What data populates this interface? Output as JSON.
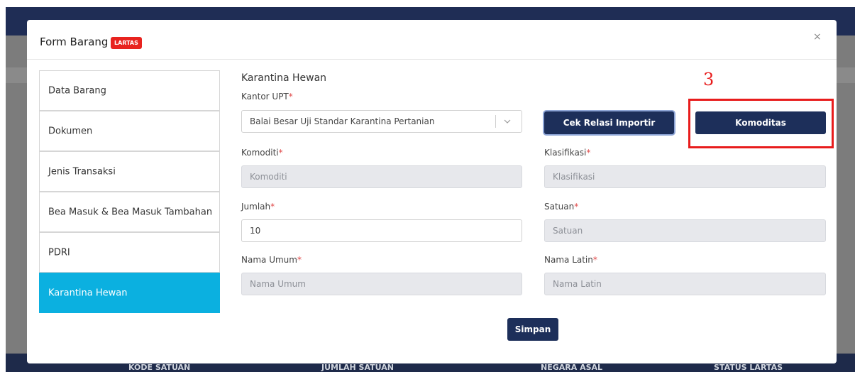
{
  "background": {
    "footer_columns": [
      "KODE SATUAN",
      "JUMLAH SATUAN",
      "NEGARA ASAL",
      "STATUS LARTAS"
    ]
  },
  "modal": {
    "title": "Form Barang",
    "badge": "LARTAS",
    "close_label": "×"
  },
  "sidebar": {
    "items": [
      {
        "label": "Data Barang",
        "active": false
      },
      {
        "label": "Dokumen",
        "active": false
      },
      {
        "label": "Jenis Transaksi",
        "active": false
      },
      {
        "label": "Bea Masuk & Bea Masuk Tambahan",
        "active": false
      },
      {
        "label": "PDRI",
        "active": false
      },
      {
        "label": "Karantina Hewan",
        "active": true
      }
    ]
  },
  "form": {
    "section_title": "Karantina Hewan",
    "kantor_upt": {
      "label": "Kantor UPT",
      "value": "Balai Besar Uji Standar Karantina Pertanian"
    },
    "cek_relasi_button": "Cek Relasi Importir",
    "komoditas_button": "Komoditas",
    "komoditi": {
      "label": "Komoditi",
      "placeholder": "Komoditi"
    },
    "klasifikasi": {
      "label": "Klasifikasi",
      "placeholder": "Klasifikasi"
    },
    "jumlah": {
      "label": "Jumlah",
      "value": "10"
    },
    "satuan": {
      "label": "Satuan",
      "placeholder": "Satuan"
    },
    "nama_umum": {
      "label": "Nama Umum",
      "placeholder": "Nama Umum"
    },
    "nama_latin": {
      "label": "Nama Latin",
      "placeholder": "Nama Latin"
    },
    "required_mark": "*",
    "submit_button": "Simpan"
  },
  "annotation": {
    "number": "3",
    "color": "#e81c1c"
  },
  "colors": {
    "primary_button": "#1d2f5a",
    "active_tab": "#0bb0e0",
    "badge": "#e8231f"
  }
}
